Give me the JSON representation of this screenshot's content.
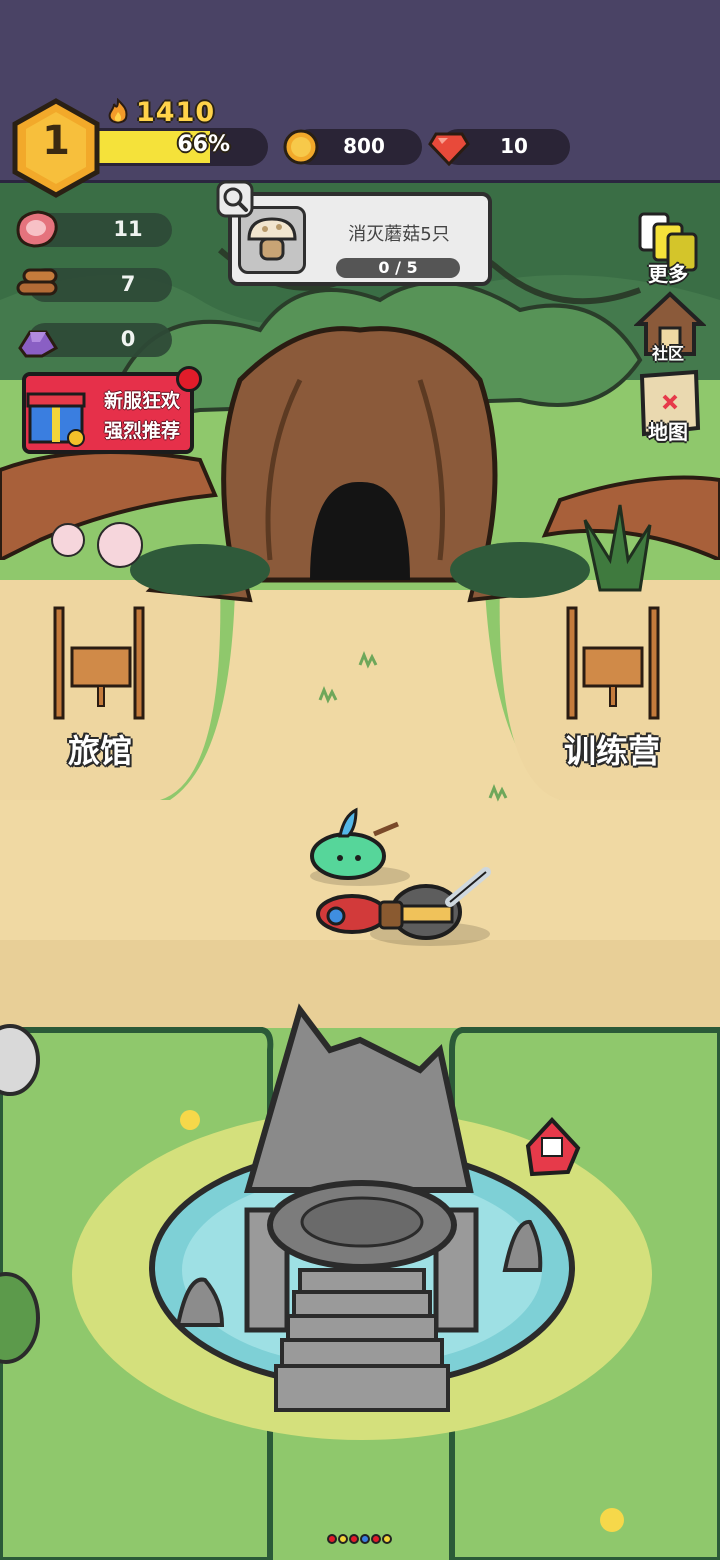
{
  "hud": {
    "level": "1",
    "power": "1410",
    "xp_percent_label": "66%",
    "xp_fraction": 0.66,
    "coins": "800",
    "gems": "10"
  },
  "resources": [
    {
      "name": "meat",
      "value": "11"
    },
    {
      "name": "wood",
      "value": "7"
    },
    {
      "name": "ore",
      "value": "0"
    }
  ],
  "quest": {
    "title": "消灭蘑菇5只",
    "progress": "0 / 5"
  },
  "promo": {
    "line1": "新服狂欢",
    "line2": "强烈推荐"
  },
  "side_menu": {
    "more": "更多",
    "community": "社区",
    "map": "地图"
  },
  "places": {
    "inn": "旅馆",
    "training": "训练营"
  },
  "colors": {
    "topbar": "#4a4365",
    "level_badge": "#f2a92a",
    "xp_fill": "#f5e23a",
    "promo": "#e6304a"
  },
  "page_dots": [
    "#e11c2a",
    "#f3d43a",
    "#e11c2a",
    "#3a7ee0",
    "#e11c2a",
    "#f3d43a"
  ]
}
